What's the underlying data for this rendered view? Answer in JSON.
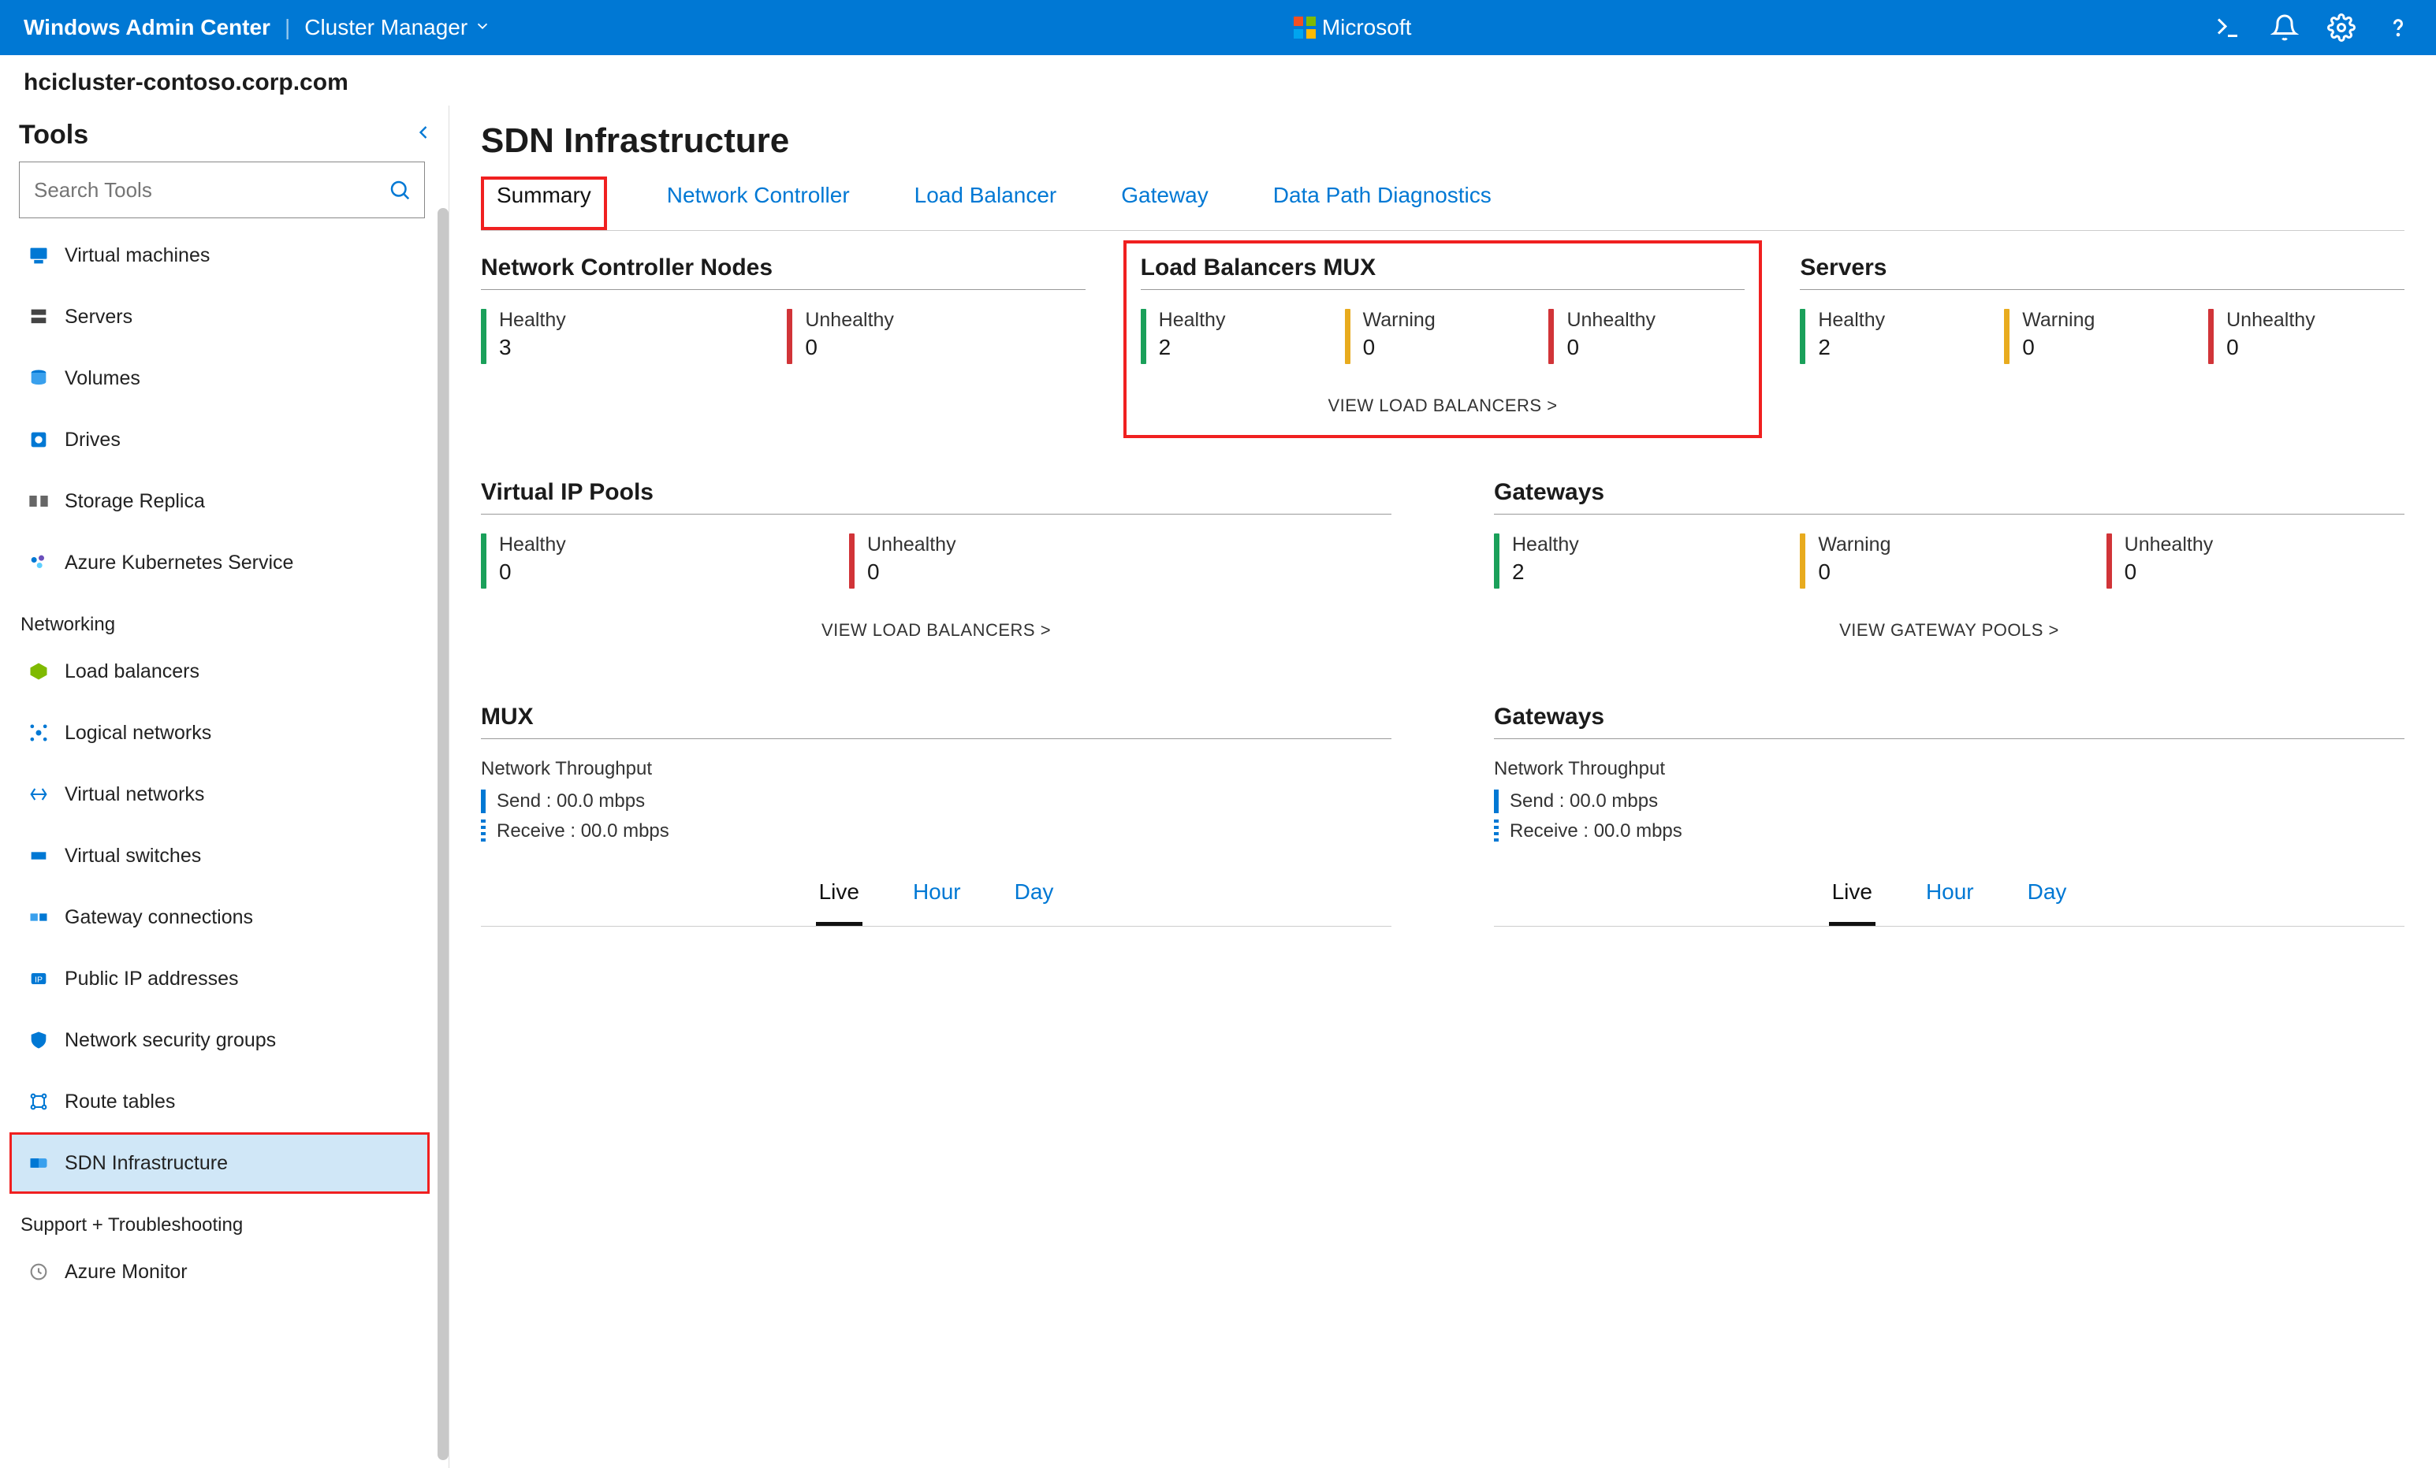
{
  "topbar": {
    "product": "Windows Admin Center",
    "section": "Cluster Manager",
    "brand": "Microsoft"
  },
  "host": "hcicluster-contoso.corp.com",
  "sidebar": {
    "title": "Tools",
    "search_placeholder": "Search Tools",
    "groups": [
      {
        "name": "",
        "items": [
          {
            "label": "Virtual machines",
            "key": "virtual-machines"
          },
          {
            "label": "Servers",
            "key": "servers"
          },
          {
            "label": "Volumes",
            "key": "volumes"
          },
          {
            "label": "Drives",
            "key": "drives"
          },
          {
            "label": "Storage Replica",
            "key": "storage-replica"
          },
          {
            "label": "Azure Kubernetes Service",
            "key": "aks"
          }
        ]
      },
      {
        "name": "Networking",
        "items": [
          {
            "label": "Load balancers",
            "key": "load-balancers"
          },
          {
            "label": "Logical networks",
            "key": "logical-networks"
          },
          {
            "label": "Virtual networks",
            "key": "virtual-networks"
          },
          {
            "label": "Virtual switches",
            "key": "virtual-switches"
          },
          {
            "label": "Gateway connections",
            "key": "gateway-connections"
          },
          {
            "label": "Public IP addresses",
            "key": "public-ip"
          },
          {
            "label": "Network security groups",
            "key": "nsg"
          },
          {
            "label": "Route tables",
            "key": "route-tables"
          },
          {
            "label": "SDN Infrastructure",
            "key": "sdn-infrastructure",
            "active": true,
            "highlight": true
          }
        ]
      },
      {
        "name": "Support + Troubleshooting",
        "items": [
          {
            "label": "Azure Monitor",
            "key": "azure-monitor"
          }
        ]
      }
    ]
  },
  "page": {
    "title": "SDN Infrastructure",
    "tabs": [
      {
        "label": "Summary",
        "active": true,
        "highlight": true
      },
      {
        "label": "Network Controller"
      },
      {
        "label": "Load Balancer"
      },
      {
        "label": "Gateway"
      },
      {
        "label": "Data Path Diagnostics"
      }
    ]
  },
  "summary": {
    "row1": [
      {
        "title": "Network Controller Nodes",
        "stats": [
          {
            "label": "Healthy",
            "value": "3",
            "color": "green"
          },
          {
            "label": "Unhealthy",
            "value": "0",
            "color": "red"
          }
        ]
      },
      {
        "title": "Load Balancers MUX",
        "highlight": true,
        "stats": [
          {
            "label": "Healthy",
            "value": "2",
            "color": "green"
          },
          {
            "label": "Warning",
            "value": "0",
            "color": "yellow"
          },
          {
            "label": "Unhealthy",
            "value": "0",
            "color": "red"
          }
        ],
        "link": "VIEW LOAD BALANCERS >"
      },
      {
        "title": "Servers",
        "stats": [
          {
            "label": "Healthy",
            "value": "2",
            "color": "green"
          },
          {
            "label": "Warning",
            "value": "0",
            "color": "yellow"
          },
          {
            "label": "Unhealthy",
            "value": "0",
            "color": "red"
          }
        ]
      }
    ],
    "row2": [
      {
        "title": "Virtual IP Pools",
        "stats": [
          {
            "label": "Healthy",
            "value": "0",
            "color": "green"
          },
          {
            "label": "Unhealthy",
            "value": "0",
            "color": "red"
          }
        ],
        "link": "VIEW LOAD BALANCERS >"
      },
      {
        "title": "Gateways",
        "stats": [
          {
            "label": "Healthy",
            "value": "2",
            "color": "green"
          },
          {
            "label": "Warning",
            "value": "0",
            "color": "yellow"
          },
          {
            "label": "Unhealthy",
            "value": "0",
            "color": "red"
          }
        ],
        "link": "VIEW GATEWAY POOLS >"
      }
    ],
    "row3": {
      "mux": {
        "title": "MUX",
        "subhead": "Network Throughput",
        "send": "Send : 00.0 mbps",
        "receive": "Receive : 00.0 mbps",
        "time_tabs": [
          "Live",
          "Hour",
          "Day"
        ],
        "time_active": "Live"
      },
      "gateways": {
        "title": "Gateways",
        "subhead": "Network Throughput",
        "send": "Send : 00.0 mbps",
        "receive": "Receive : 00.0 mbps",
        "time_tabs": [
          "Live",
          "Hour",
          "Day"
        ],
        "time_active": "Live"
      }
    }
  }
}
